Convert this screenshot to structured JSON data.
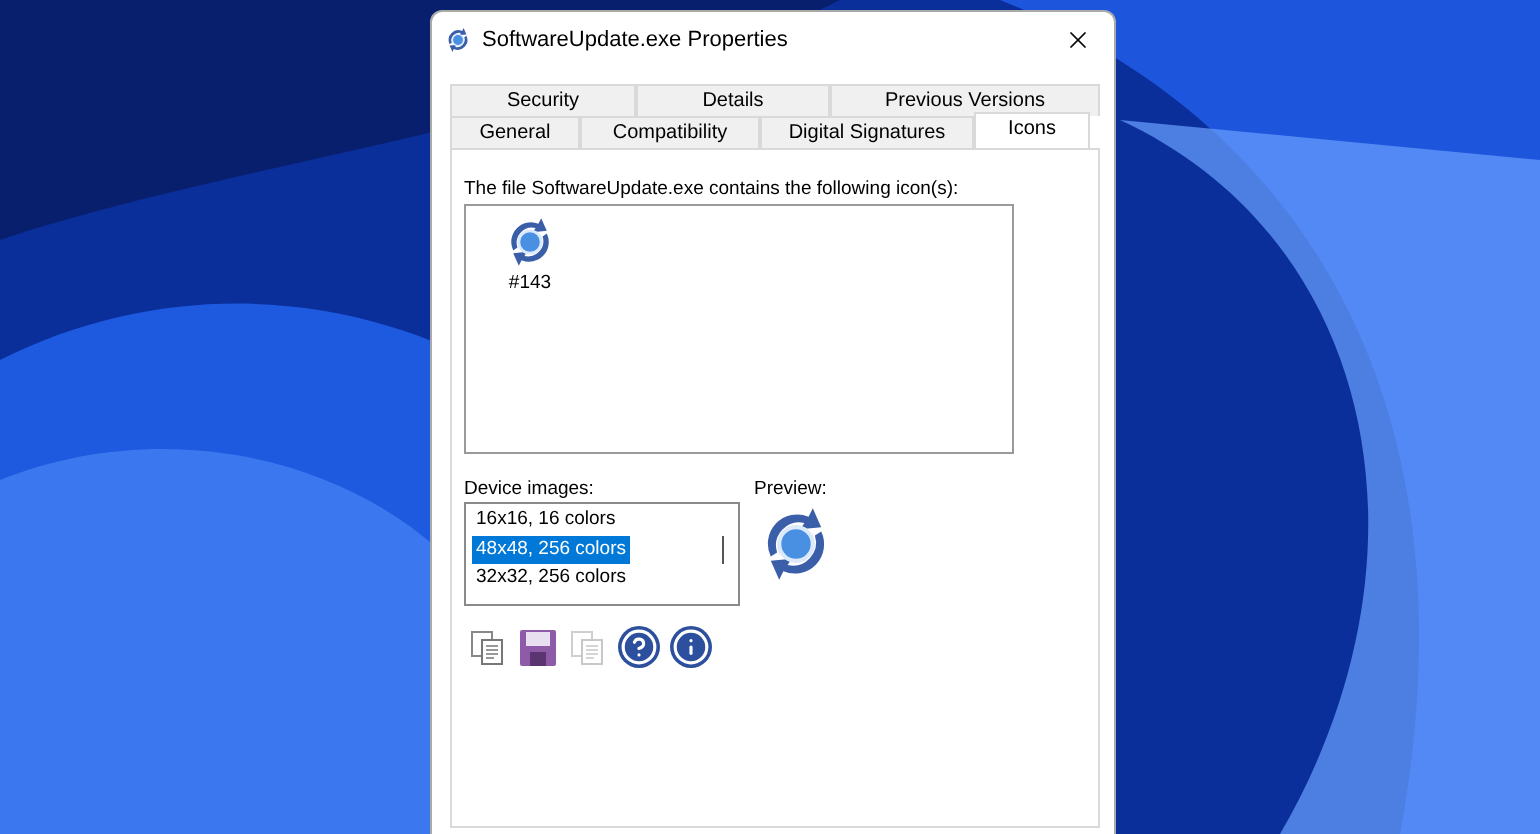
{
  "window": {
    "title": "SoftwareUpdate.exe Properties"
  },
  "tabs": {
    "back_row": [
      {
        "label": "Security",
        "selected": false
      },
      {
        "label": "Details",
        "selected": false
      },
      {
        "label": "Previous Versions",
        "selected": false
      }
    ],
    "front_row": [
      {
        "label": "General",
        "selected": false
      },
      {
        "label": "Compatibility",
        "selected": false
      },
      {
        "label": "Digital Signatures",
        "selected": false
      },
      {
        "label": "Icons",
        "selected": true
      }
    ]
  },
  "icons_panel": {
    "caption": "The file SoftwareUpdate.exe contains the following icon(s):",
    "icons": [
      {
        "label": "#143",
        "selected": false
      }
    ]
  },
  "device_images": {
    "label": "Device images:",
    "items": [
      {
        "label": "16x16, 16 colors",
        "selected": false
      },
      {
        "label": "48x48, 256 colors",
        "selected": true
      },
      {
        "label": "32x32, 256 colors",
        "selected": false
      }
    ]
  },
  "preview": {
    "label": "Preview:"
  },
  "toolbar": [
    {
      "kind": "copy",
      "disabled": false
    },
    {
      "kind": "save",
      "disabled": false
    },
    {
      "kind": "copy-all",
      "disabled": true
    },
    {
      "kind": "help",
      "disabled": false
    },
    {
      "kind": "info",
      "disabled": false
    }
  ]
}
